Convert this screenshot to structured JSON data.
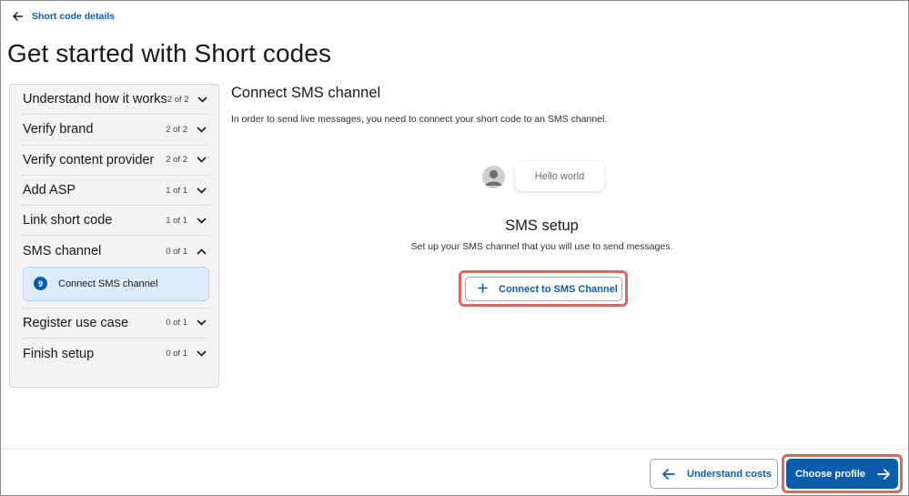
{
  "header": {
    "back_link_label": "Short code details",
    "page_title": "Get started with Short codes"
  },
  "sidebar": {
    "steps": [
      {
        "label": "Understand how it works",
        "count": "2 of 2",
        "expanded": false
      },
      {
        "label": "Verify brand",
        "count": "2 of 2",
        "expanded": false
      },
      {
        "label": "Verify content provider",
        "count": "2 of 2",
        "expanded": false
      },
      {
        "label": "Add ASP",
        "count": "1 of 1",
        "expanded": false
      },
      {
        "label": "Link short code",
        "count": "1 of 1",
        "expanded": false
      },
      {
        "label": "SMS channel",
        "count": "0 of 1",
        "expanded": true
      },
      {
        "label": "Register use case",
        "count": "0 of 1",
        "expanded": false
      },
      {
        "label": "Finish setup",
        "count": "0 of 1",
        "expanded": false
      }
    ],
    "active_substep": {
      "number": "9",
      "label": "Connect SMS channel"
    }
  },
  "main": {
    "heading": "Connect SMS channel",
    "description": "In order to send live messages, you need to connect your short code to an SMS channel.",
    "preview_bubble": "Hello world",
    "setup_title": "SMS setup",
    "setup_description": "Set up your SMS channel that you will use to send messages.",
    "connect_button_label": "Connect to SMS Channel"
  },
  "footer": {
    "back_button_label": "Understand costs",
    "next_button_label": "Choose profile"
  },
  "colors": {
    "accent": "#0b5cab",
    "highlight": "#e0655f",
    "sidebar_bg": "#f3f3f3",
    "active_substep_bg": "#dcecfa"
  },
  "icons": {
    "back": "arrow-left-icon",
    "chevron_collapsed": "chevron-down-icon",
    "chevron_expanded": "chevron-up-icon",
    "connect": "plus-icon",
    "next": "arrow-right-icon",
    "avatar": "user-avatar-icon"
  }
}
